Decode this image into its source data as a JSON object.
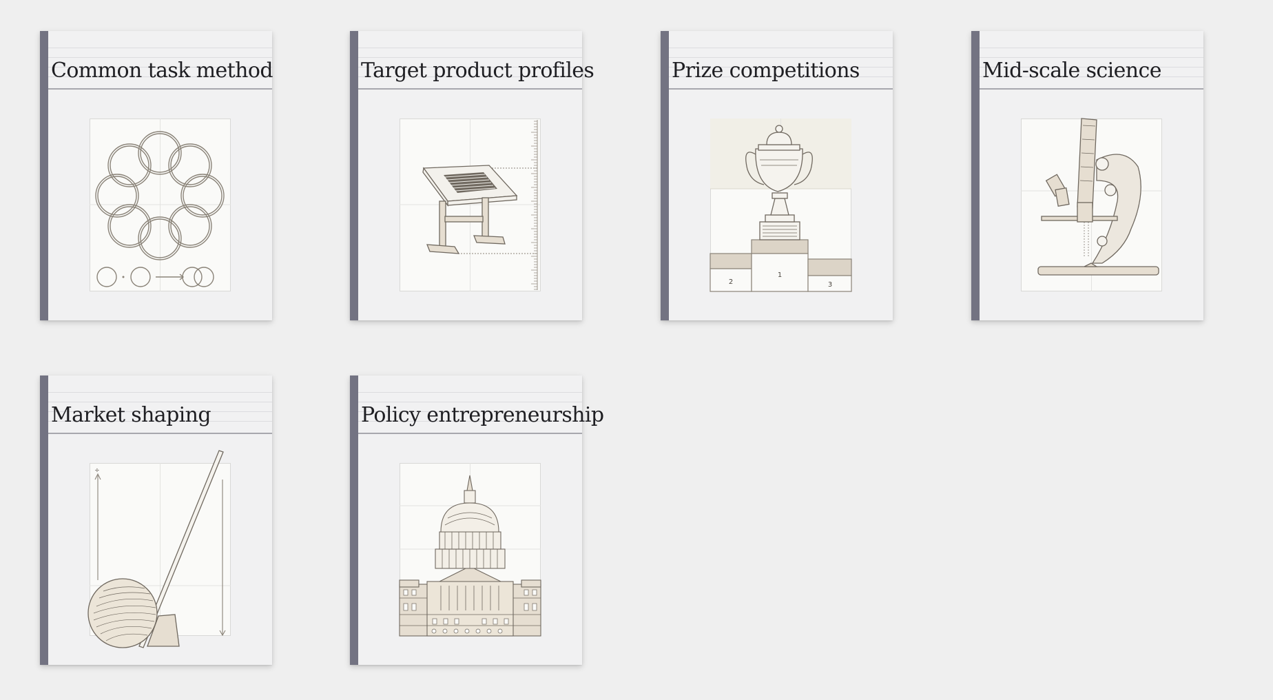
{
  "cards": [
    {
      "title": "Common task method",
      "icon": "interlocking-rings"
    },
    {
      "title": "Target product profiles",
      "icon": "drafting-table"
    },
    {
      "title": "Prize competitions",
      "icon": "trophy-podium"
    },
    {
      "title": "Mid-scale science",
      "icon": "microscope"
    },
    {
      "title": "Market shaping",
      "icon": "ball-and-lever"
    },
    {
      "title": "Policy entrepreneurship",
      "icon": "capitol-building"
    }
  ],
  "podium": {
    "first": "1",
    "second": "2",
    "third": "3"
  },
  "colors": {
    "background": "#efefef",
    "card": "#f1f1f2",
    "spine": "#737382",
    "illustration_line": "#8a8378",
    "illustration_fill": "#dcd4c7"
  }
}
